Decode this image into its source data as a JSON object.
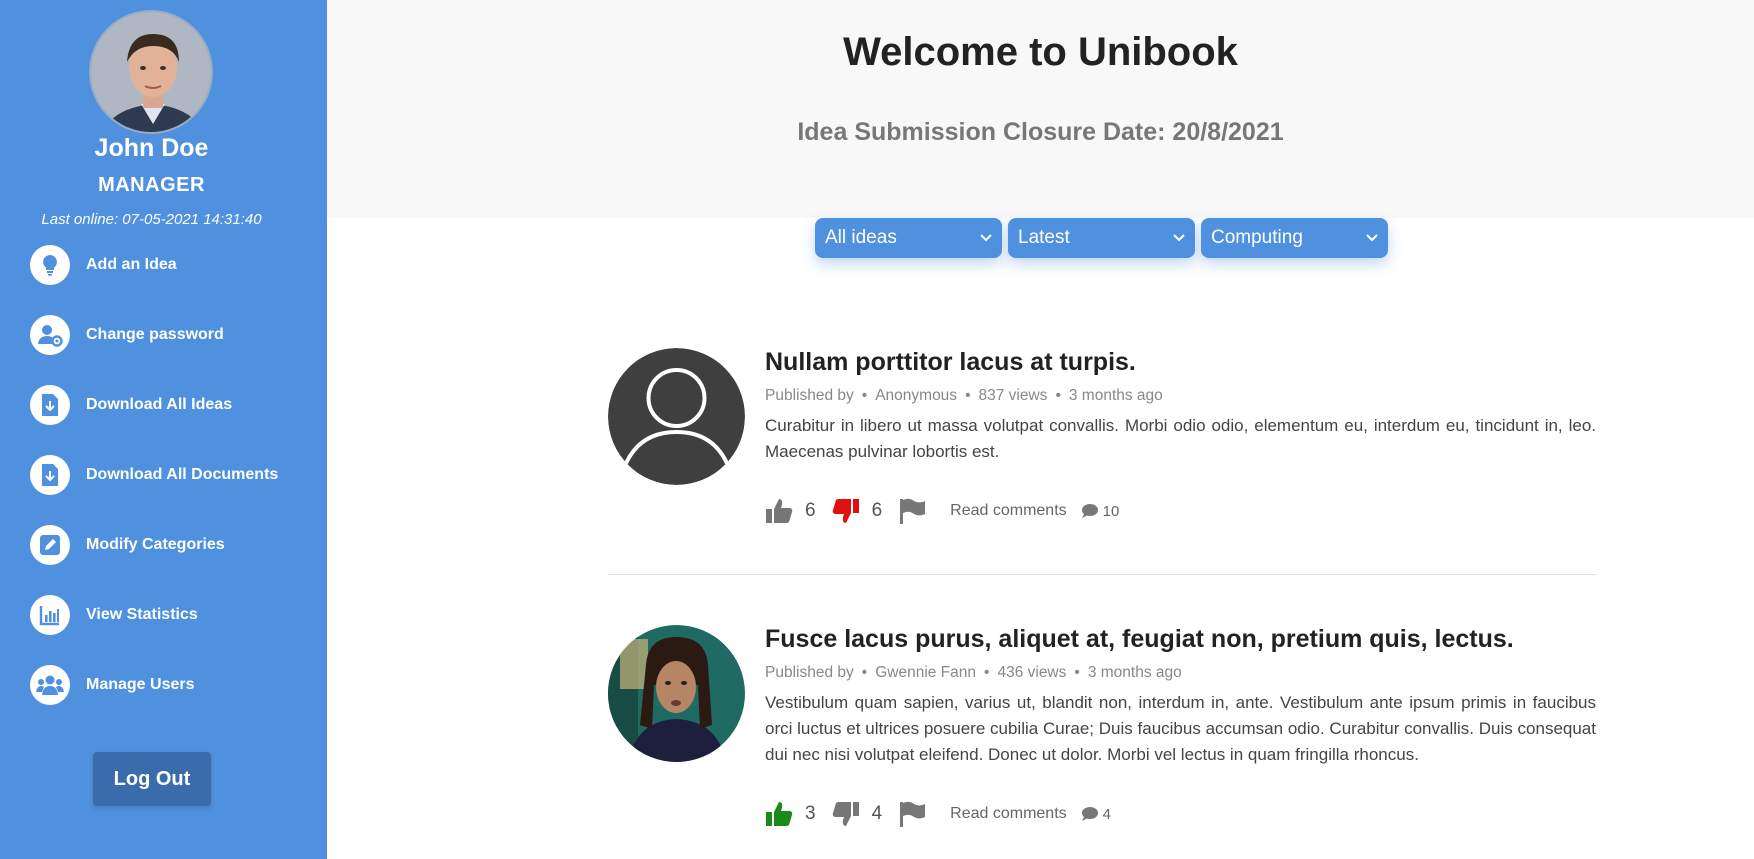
{
  "user": {
    "name": "John Doe",
    "role": "MANAGER",
    "last_online": "Last online: 07-05-2021 14:31:40"
  },
  "sidebar": {
    "items": [
      {
        "label": "Add an Idea",
        "icon": "lightbulb-icon"
      },
      {
        "label": "Change password",
        "icon": "user-gear-icon"
      },
      {
        "label": "Download All Ideas",
        "icon": "file-download-icon"
      },
      {
        "label": "Download All Documents",
        "icon": "file-download-icon"
      },
      {
        "label": "Modify Categories",
        "icon": "edit-icon"
      },
      {
        "label": "View Statistics",
        "icon": "chart-icon"
      },
      {
        "label": "Manage Users",
        "icon": "users-icon"
      }
    ],
    "logout_label": "Log Out"
  },
  "header": {
    "title": "Welcome to Unibook",
    "closure_date": "Idea Submission Closure Date: 20/8/2021"
  },
  "filters": [
    {
      "selected": "All ideas"
    },
    {
      "selected": "Latest"
    },
    {
      "selected": "Computing"
    }
  ],
  "ideas": [
    {
      "title": "Nullam porttitor lacus at turpis.",
      "published_by": "Published by",
      "author": "Anonymous",
      "views": "837 views",
      "time": "3 months ago",
      "body": "Curabitur in libero ut massa volutpat convallis. Morbi odio odio, elementum eu, interdum eu, tincidunt in, leo. Maecenas pulvinar lobortis est.",
      "likes": "6",
      "dislikes": "6",
      "liked": false,
      "disliked": true,
      "read_comments": "Read comments",
      "comments": "10"
    },
    {
      "title": "Fusce lacus purus, aliquet at, feugiat non, pretium quis, lectus.",
      "published_by": "Published by",
      "author": "Gwennie Fann",
      "views": "436 views",
      "time": "3 months ago",
      "body": "Vestibulum quam sapien, varius ut, blandit non, interdum in, ante. Vestibulum ante ipsum primis in faucibus orci luctus et ultrices posuere cubilia Curae; Duis faucibus accumsan odio. Curabitur convallis. Duis consequat dui nec nisi volutpat eleifend. Donec ut dolor. Morbi vel lectus in quam fringilla rhoncus.",
      "likes": "3",
      "dislikes": "4",
      "liked": true,
      "disliked": false,
      "read_comments": "Read comments",
      "comments": "4"
    }
  ],
  "colors": {
    "sidebar": "#4f91df",
    "logout": "#3a6bab",
    "like_active": "#1a8a1a",
    "dislike_active": "#e01010",
    "inactive": "#777777"
  }
}
